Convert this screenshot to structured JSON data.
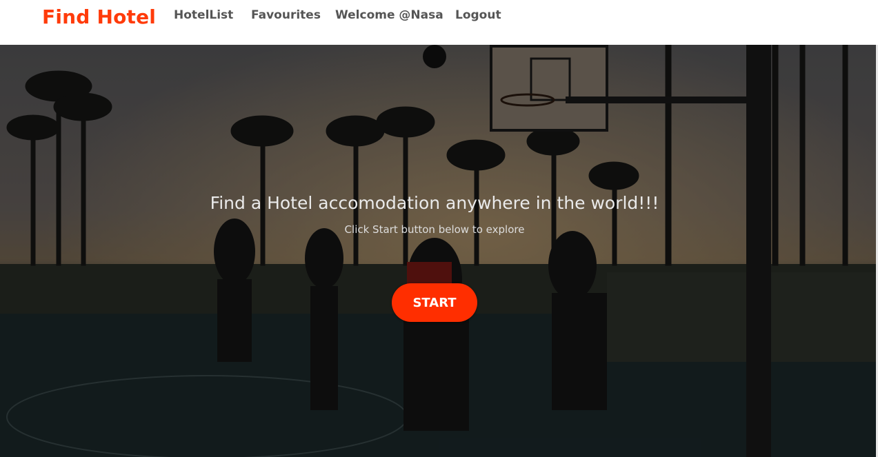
{
  "navbar": {
    "brand": "Find Hotel",
    "links": [
      "HotelList",
      "Favourites",
      "Welcome @Nasa",
      "Logout"
    ]
  },
  "hero": {
    "title": "Find a Hotel accomodation anywhere in the world!!!",
    "subtitle": "Click Start button below to explore",
    "button_label": "START"
  },
  "colors": {
    "brand": "#ff3b0a",
    "button": "#ff2e00",
    "nav_text": "#555555"
  }
}
